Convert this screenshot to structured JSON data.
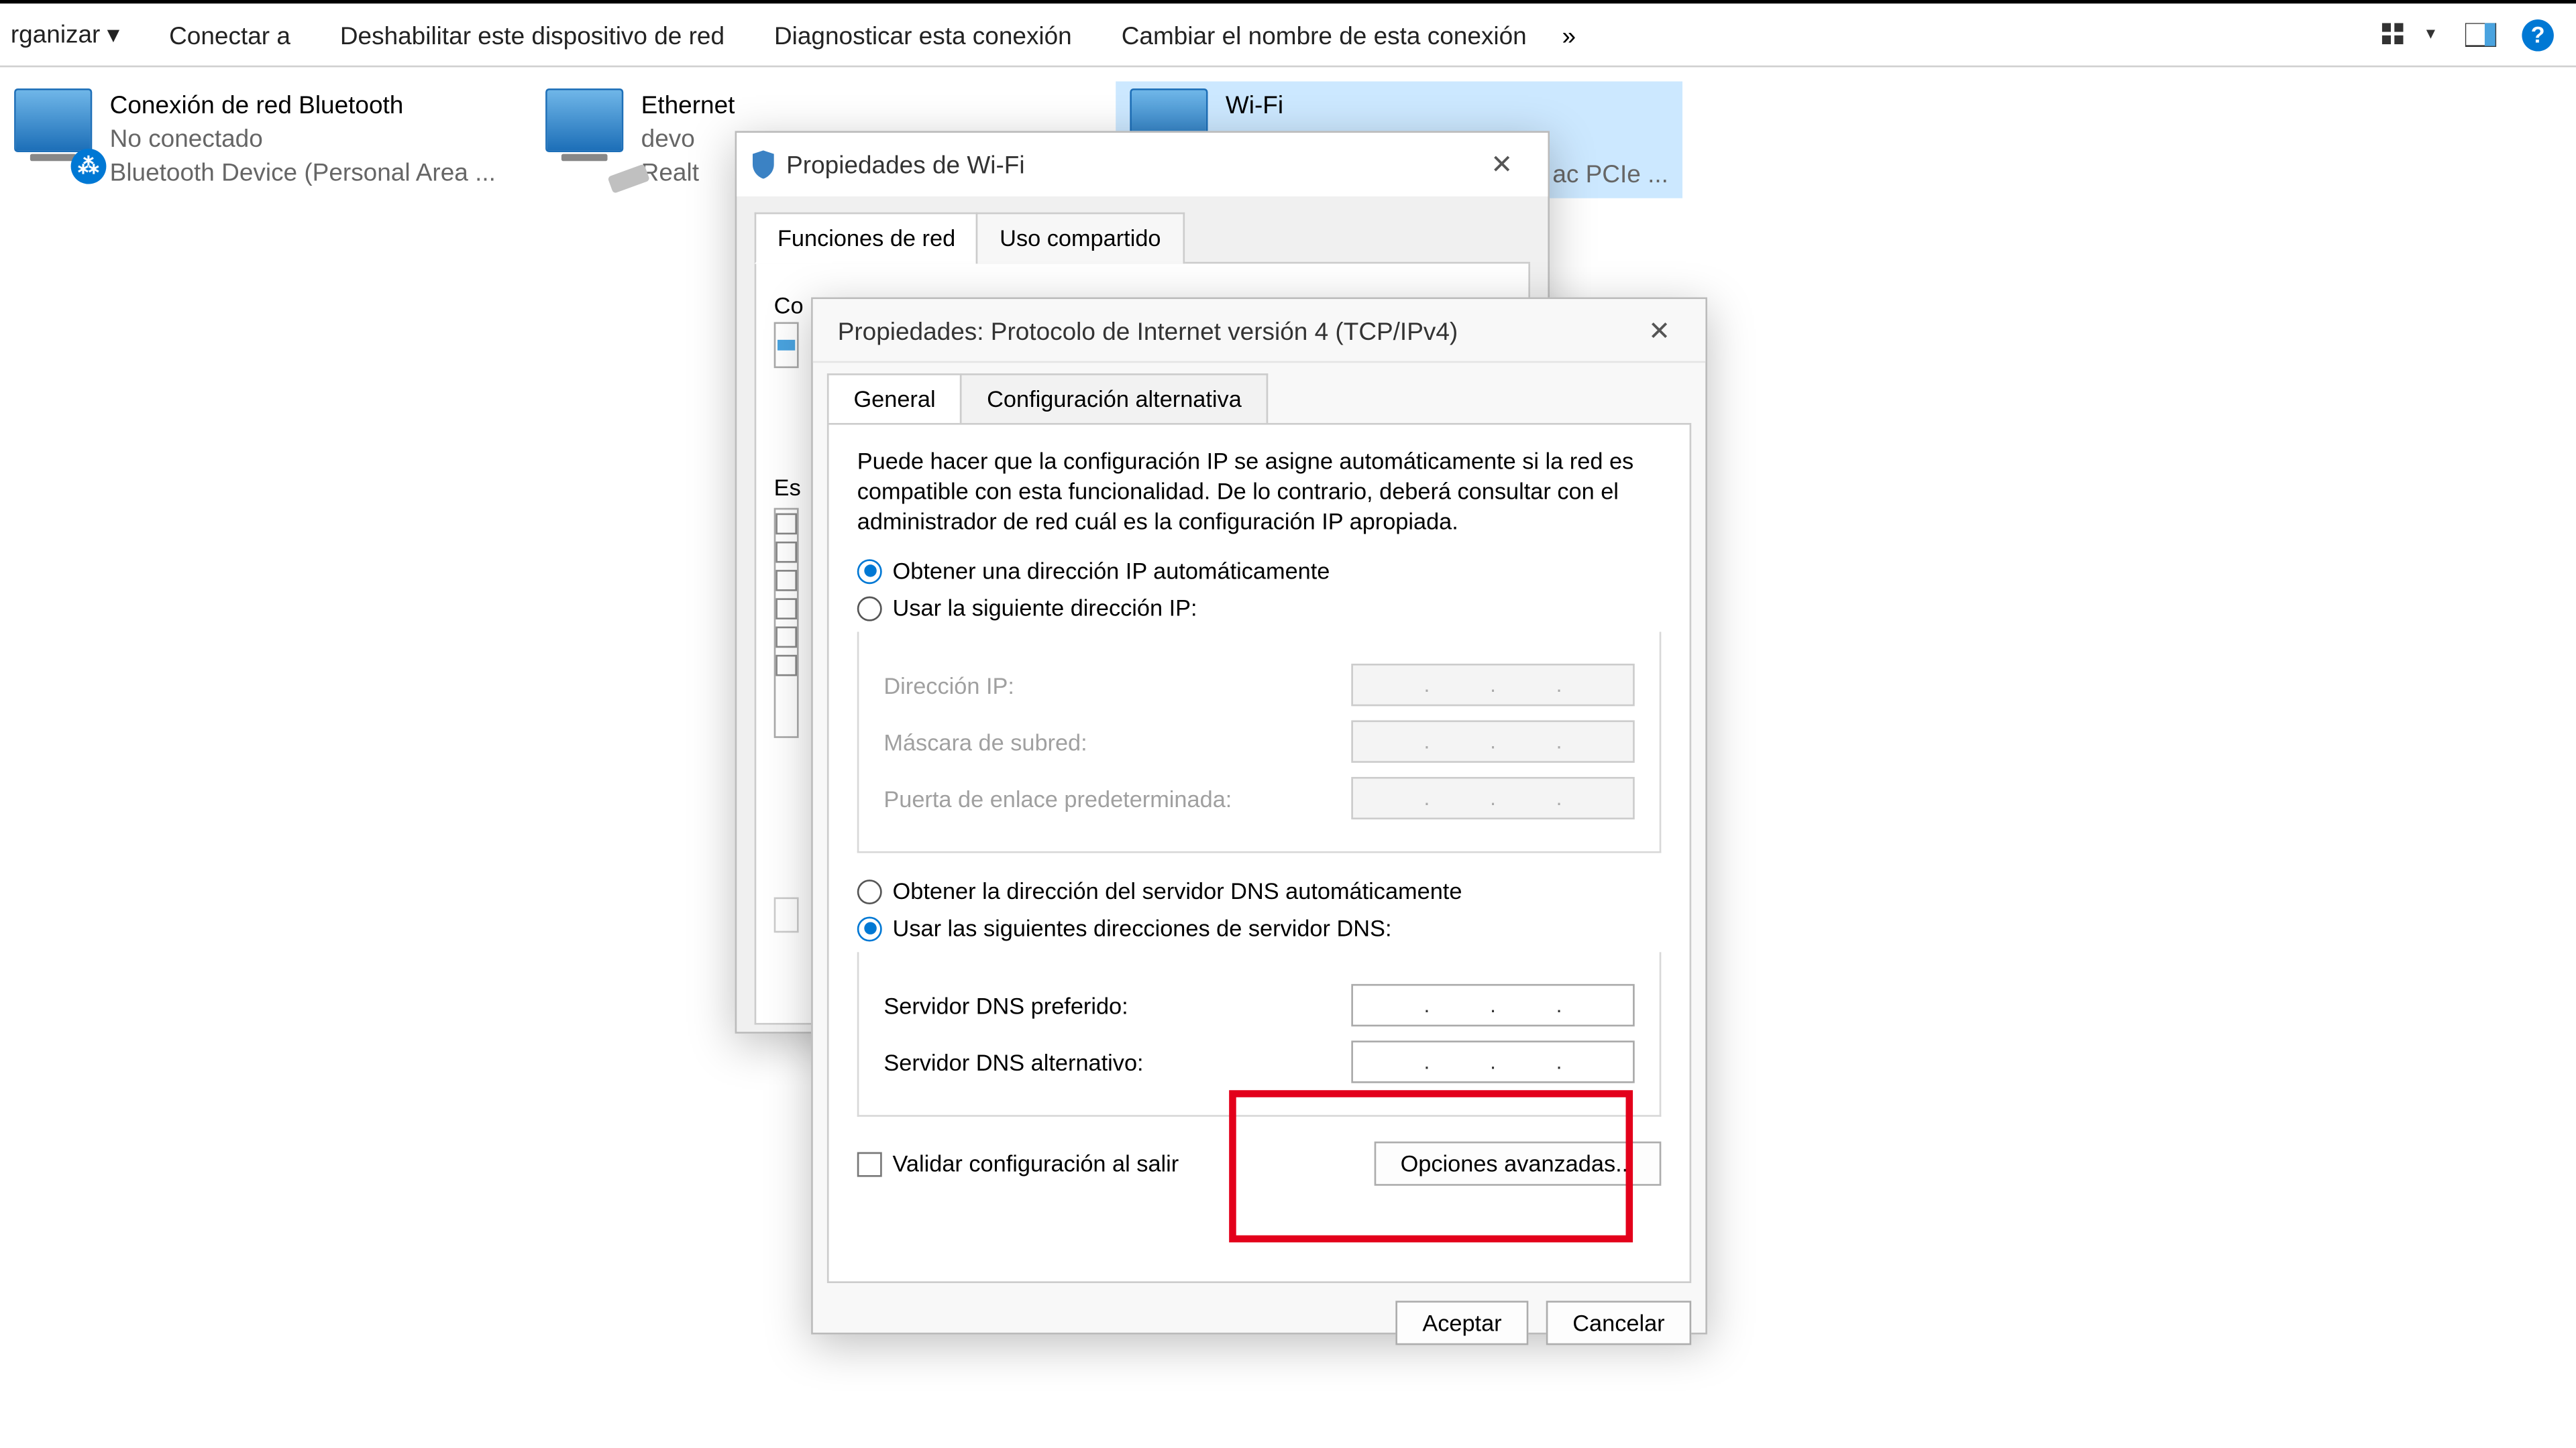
{
  "toolbar": {
    "organize": "rganizar ▾",
    "connect": "Conectar a",
    "disable": "Deshabilitar este dispositivo de red",
    "diagnose": "Diagnosticar esta conexión",
    "rename": "Cambiar el nombre de esta conexión",
    "overflow": "»"
  },
  "connections": {
    "bt": {
      "title": "Conexión de red Bluetooth",
      "status": "No conectado",
      "device": "Bluetooth Device (Personal Area ..."
    },
    "eth": {
      "title": "Ethernet",
      "status": "devo",
      "device": "Realt"
    },
    "wifi": {
      "title": "Wi-Fi",
      "device_tail": "ac PCIe ..."
    }
  },
  "wifiDialog": {
    "title": "Propiedades de Wi-Fi",
    "tab_functions": "Funciones de red",
    "tab_sharing": "Uso compartido",
    "connect_header": "Co",
    "es_label": "Es"
  },
  "ipDialog": {
    "title": "Propiedades: Protocolo de Internet versión 4 (TCP/IPv4)",
    "tab_general": "General",
    "tab_alt": "Configuración alternativa",
    "desc": "Puede hacer que la configuración IP se asigne automáticamente si la red es compatible con esta funcionalidad. De lo contrario, deberá consultar con el administrador de red cuál es la configuración IP apropiada.",
    "radio_ip_auto": "Obtener una dirección IP automáticamente",
    "radio_ip_manual": "Usar la siguiente dirección IP:",
    "ip_label": "Dirección IP:",
    "mask_label": "Máscara de subred:",
    "gw_label": "Puerta de enlace predeterminada:",
    "radio_dns_auto": "Obtener la dirección del servidor DNS automáticamente",
    "radio_dns_manual": "Usar las siguientes direcciones de servidor DNS:",
    "dns_pref": "Servidor DNS preferido:",
    "dns_alt": "Servidor DNS alternativo:",
    "validate": "Validar configuración al salir",
    "advanced": "Opciones avanzadas...",
    "ok": "Aceptar",
    "cancel": "Cancelar"
  }
}
